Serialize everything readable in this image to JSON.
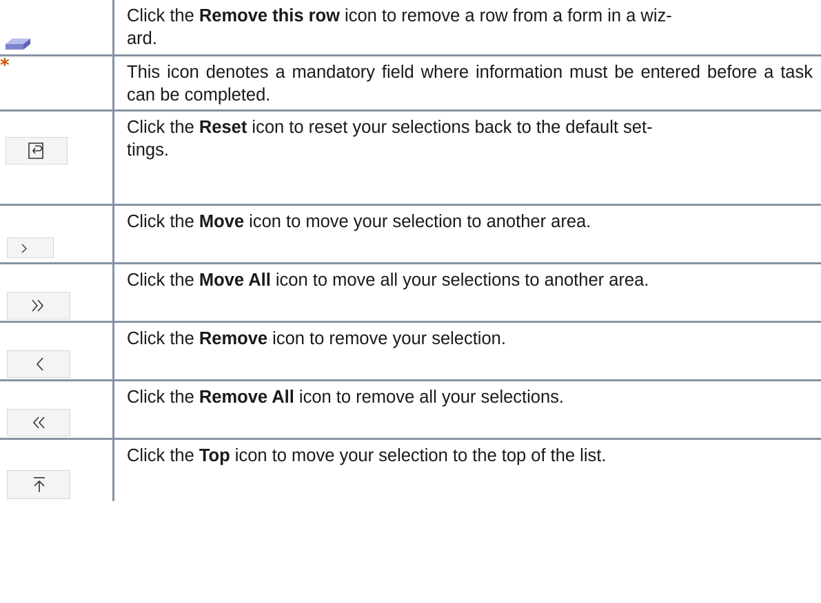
{
  "rows": [
    {
      "icon": "eraser-icon",
      "pre": "Click the ",
      "bold": "Remove this row",
      "post": " icon to remove a row from a form in a wiz-\nard."
    },
    {
      "icon": "asterisk-icon",
      "icon_text": "*",
      "pre": "This icon denotes a mandatory field where information must be entered before a task can be completed.",
      "bold": "",
      "post": ""
    },
    {
      "icon": "reset-icon",
      "pre": "Click the ",
      "bold": "Reset",
      "post": " icon to reset your selections back to the default set-\ntings."
    },
    {
      "icon": "move-icon",
      "pre": "Click the ",
      "bold": "Move",
      "post": " icon to move your selection to another area."
    },
    {
      "icon": "move-all-icon",
      "pre": "Click the ",
      "bold": "Move All",
      "post": " icon to move all your selections to another area."
    },
    {
      "icon": "remove-icon",
      "pre": "Click the ",
      "bold": "Remove",
      "post": " icon to remove your selection."
    },
    {
      "icon": "remove-all-icon",
      "pre": "Click the ",
      "bold": "Remove All",
      "post": " icon to remove all your selections."
    },
    {
      "icon": "top-icon",
      "pre": "Click the ",
      "bold": "Top",
      "post": " icon to move your selection to the top of the list."
    }
  ],
  "colors": {
    "border": "#8793a5",
    "asterisk": "#d35400",
    "eraser": "#8a8fd6"
  }
}
